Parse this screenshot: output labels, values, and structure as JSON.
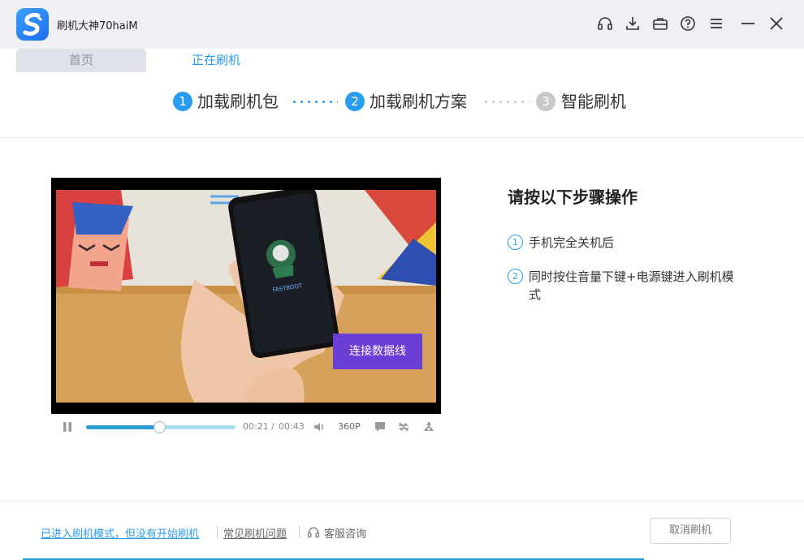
{
  "app": {
    "title": "刷机大神70haiM"
  },
  "tabs": [
    {
      "label": "首页",
      "active": false
    },
    {
      "label": "正在刷机",
      "active": true
    }
  ],
  "steps": [
    {
      "number": "1",
      "label": "加载刷机包",
      "state": "done"
    },
    {
      "number": "2",
      "label": "加载刷机方案",
      "state": "current"
    },
    {
      "number": "3",
      "label": "智能刷机",
      "state": "pending"
    }
  ],
  "video": {
    "cta_label": "连接数据线",
    "screen_text": "FASTBOOT",
    "current_time": "00:21",
    "separator": "/",
    "duration": "00:43",
    "quality": "360P",
    "progress": 0.49
  },
  "instructions": {
    "title": "请按以下步骤操作",
    "items": [
      {
        "number": "1",
        "text": "手机完全关机后"
      },
      {
        "number": "2",
        "text": "同时按住音量下键+电源键进入刷机模式"
      }
    ]
  },
  "footer": {
    "link_entered": "已进入刷机模式，但没有开始刷机",
    "link_faq": "常见刷机问题",
    "link_support": "客服咨询",
    "cancel_label": "取消刷机"
  },
  "colors": {
    "accent": "#2a9cf0",
    "pending": "#c8c8c8",
    "cta": "#6a3fd6"
  }
}
